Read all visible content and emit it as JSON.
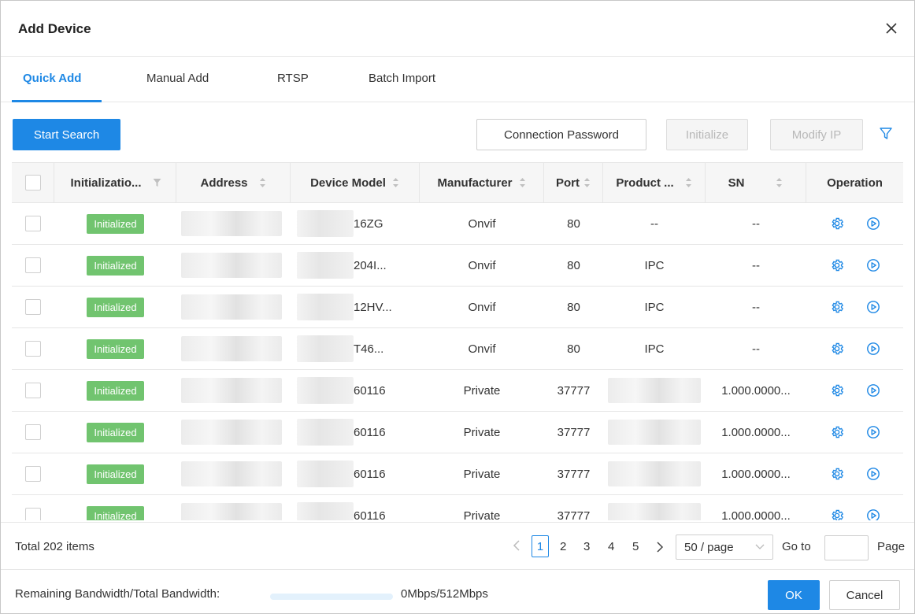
{
  "dialog": {
    "title": "Add Device"
  },
  "tabs": [
    {
      "label": "Quick Add",
      "active": true
    },
    {
      "label": "Manual Add",
      "active": false
    },
    {
      "label": "RTSP",
      "active": false
    },
    {
      "label": "Batch Import",
      "active": false
    }
  ],
  "toolbar": {
    "start_search": "Start Search",
    "connection_password": "Connection Password",
    "initialize": "Initialize",
    "modify_ip": "Modify IP"
  },
  "table": {
    "columns": [
      "Initializatio...",
      "Address",
      "Device Model",
      "Manufacturer",
      "Port",
      "Product ...",
      "SN",
      "Operation"
    ],
    "rows": [
      {
        "status": "Initialized",
        "model": "16ZG",
        "manufacturer": "Onvif",
        "port": "80",
        "product": "--",
        "sn": "--"
      },
      {
        "status": "Initialized",
        "model": "204I...",
        "manufacturer": "Onvif",
        "port": "80",
        "product": "IPC",
        "sn": "--"
      },
      {
        "status": "Initialized",
        "model": "12HV...",
        "manufacturer": "Onvif",
        "port": "80",
        "product": "IPC",
        "sn": "--"
      },
      {
        "status": "Initialized",
        "model": "T46...",
        "manufacturer": "Onvif",
        "port": "80",
        "product": "IPC",
        "sn": "--"
      },
      {
        "status": "Initialized",
        "model": "60116",
        "manufacturer": "Private",
        "port": "37777",
        "product": "",
        "sn": "1.000.0000..."
      },
      {
        "status": "Initialized",
        "model": "60116",
        "manufacturer": "Private",
        "port": "37777",
        "product": "",
        "sn": "1.000.0000..."
      },
      {
        "status": "Initialized",
        "model": "60116",
        "manufacturer": "Private",
        "port": "37777",
        "product": "",
        "sn": "1.000.0000..."
      },
      {
        "status": "Initialized",
        "model": "60116",
        "manufacturer": "Private",
        "port": "37777",
        "product": "",
        "sn": "1.000.0000..."
      }
    ]
  },
  "pagination": {
    "total": "Total 202 items",
    "pages": [
      "1",
      "2",
      "3",
      "4",
      "5"
    ],
    "current": "1",
    "page_size": "50 / page",
    "goto_label": "Go to",
    "page_label": "Page"
  },
  "bandwidth": {
    "label": "Remaining Bandwidth/Total Bandwidth:",
    "value": "0Mbps/512Mbps",
    "used_fraction": 0
  },
  "actions": {
    "ok": "OK",
    "cancel": "Cancel"
  },
  "colors": {
    "accent": "#1e88e5",
    "status_initialized": "#71c46f"
  }
}
